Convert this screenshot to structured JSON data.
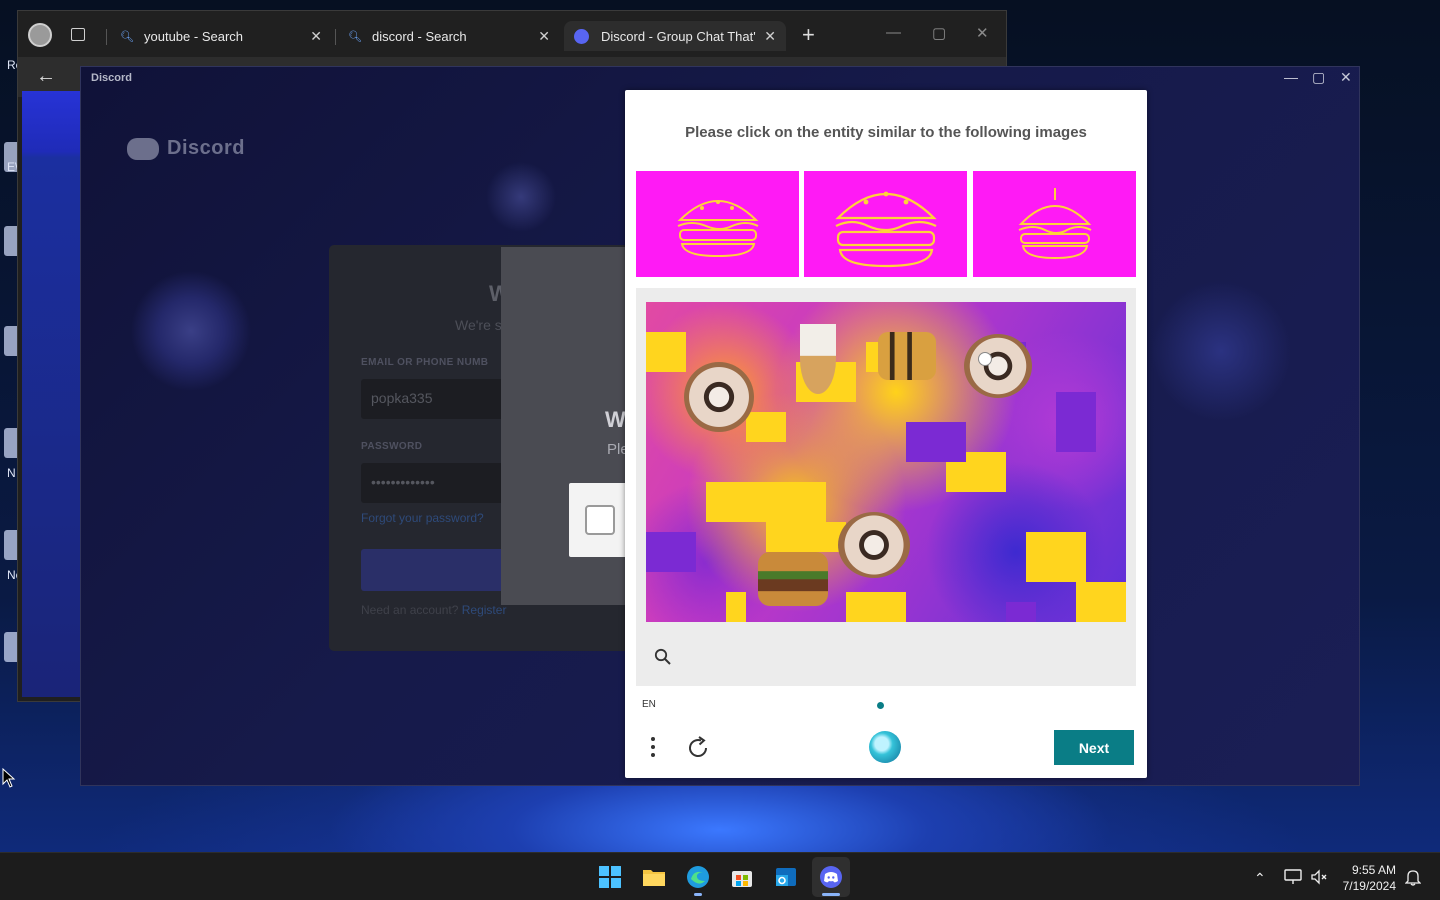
{
  "desktop": {
    "labels": [
      "Re",
      "E\\",
      "(",
      "N",
      "Nc"
    ]
  },
  "browser": {
    "tabs": [
      {
        "title": "youtube - Search"
      },
      {
        "title": "discord - Search"
      },
      {
        "title": "Discord - Group Chat That's Al"
      }
    ]
  },
  "discord": {
    "window_title": "Discord",
    "logo_text": "Discord",
    "heading": "W",
    "subheading": "We're s",
    "email_label": "EMAIL OR PHONE NUMB",
    "email_value": "popka335",
    "password_label": "PASSWORD",
    "password_value": "•••••••••••••",
    "forgot_link": "Forgot your password?",
    "footer_text": "Need an account?",
    "register_link": "Register",
    "overlay_title": "W",
    "overlay_text": "Ple"
  },
  "captcha": {
    "prompt": "Please click on the entity similar to the following images",
    "language": "EN",
    "next_label": "Next",
    "progress_current": 1,
    "progress_total": 1
  },
  "taskbar": {
    "time": "9:55 AM",
    "date": "7/19/2024"
  },
  "colors": {
    "accent": "#0a7d86",
    "example_bg": "#ff1af5",
    "discord_brand": "#5865f2"
  }
}
